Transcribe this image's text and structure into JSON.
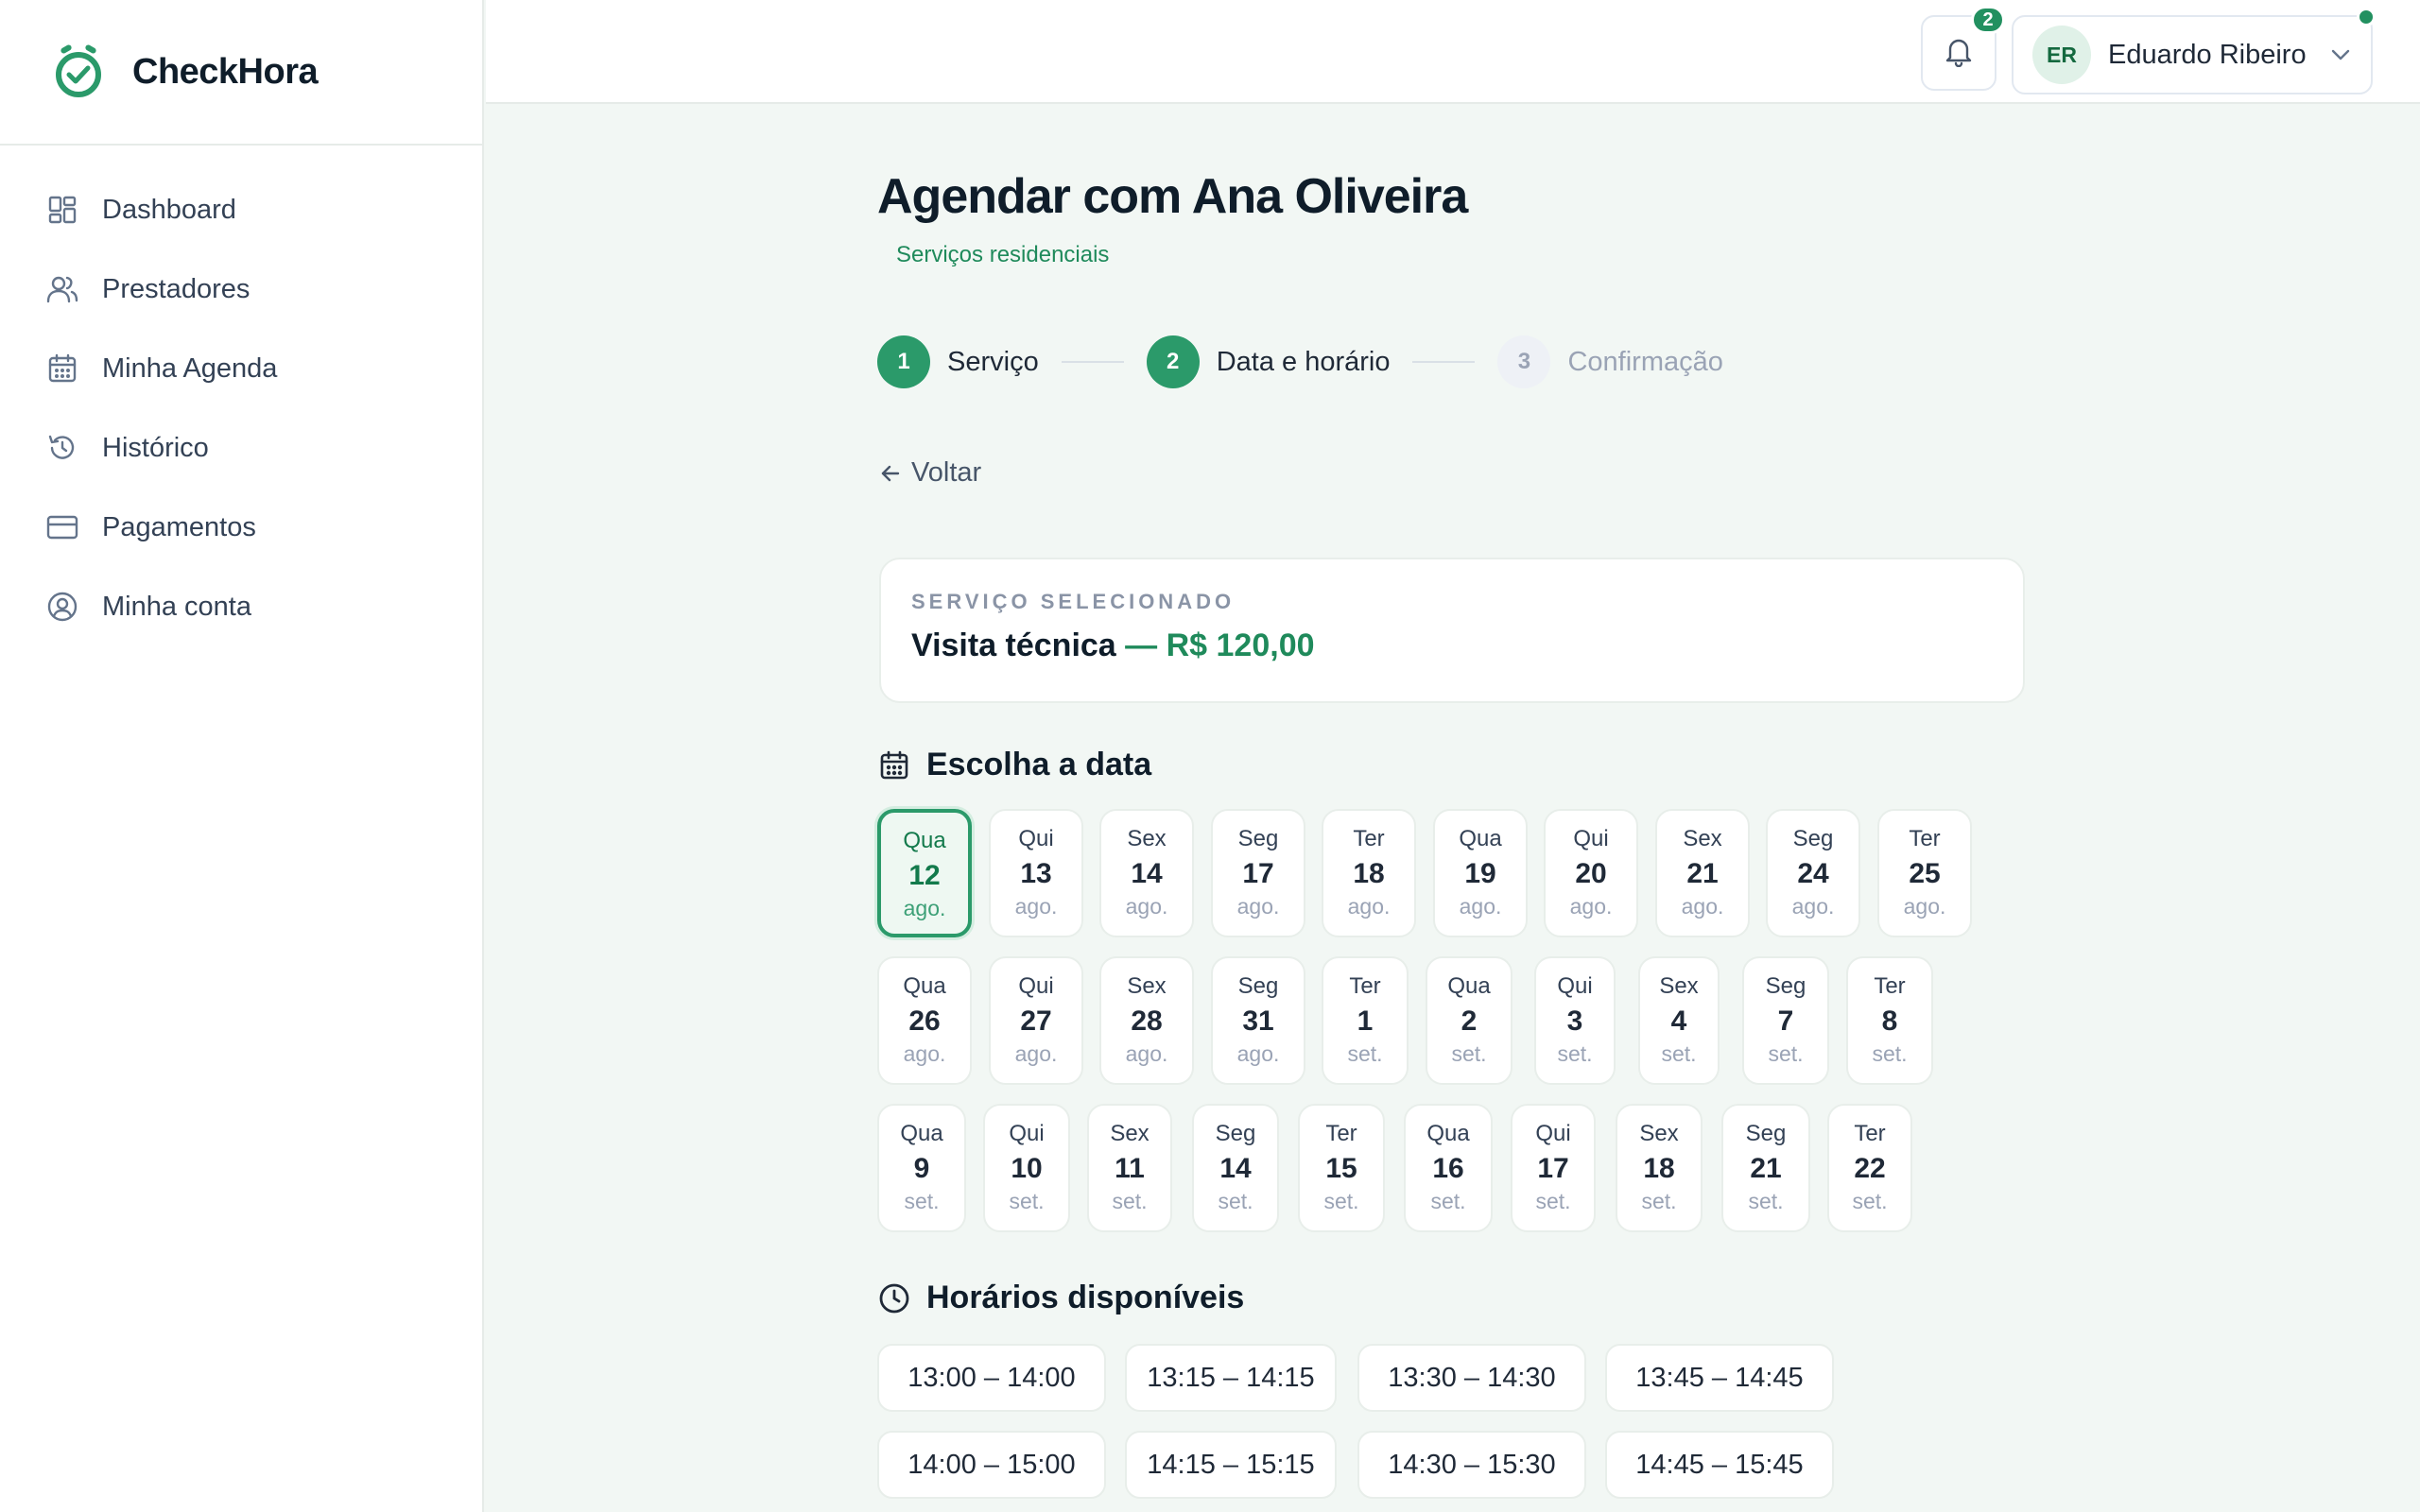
{
  "brand": {
    "name": "CheckHora"
  },
  "sidebar": {
    "items": [
      {
        "label": "Dashboard",
        "icon": "dashboard-icon"
      },
      {
        "label": "Prestadores",
        "icon": "users-icon"
      },
      {
        "label": "Minha Agenda",
        "icon": "calendar-icon"
      },
      {
        "label": "Histórico",
        "icon": "history-icon"
      },
      {
        "label": "Pagamentos",
        "icon": "credit-card-icon"
      },
      {
        "label": "Minha conta",
        "icon": "user-circle-icon"
      }
    ]
  },
  "header": {
    "notifications_count": "2",
    "user": {
      "initials": "ER",
      "name": "Eduardo Ribeiro",
      "status_color": "#229060"
    }
  },
  "page": {
    "title": "Agendar com Ana Oliveira",
    "subtitle": "Serviços residenciais",
    "back_label": "Voltar"
  },
  "stepper": {
    "steps": [
      {
        "number": "1",
        "label": "Serviço",
        "state": "done"
      },
      {
        "number": "2",
        "label": "Data e horário",
        "state": "current"
      },
      {
        "number": "3",
        "label": "Confirmação",
        "state": "pending"
      }
    ]
  },
  "service": {
    "caption": "SERVIÇO SELECIONADO",
    "name": "Visita técnica",
    "price": " — R$ 120,00"
  },
  "dates": {
    "title": "Escolha a data",
    "selected_index": 0,
    "rows": [
      [
        {
          "dow": "Qua",
          "day": "12",
          "month": "ago."
        },
        {
          "dow": "Qui",
          "day": "13",
          "month": "ago."
        },
        {
          "dow": "Sex",
          "day": "14",
          "month": "ago."
        },
        {
          "dow": "Seg",
          "day": "17",
          "month": "ago."
        },
        {
          "dow": "Ter",
          "day": "18",
          "month": "ago."
        },
        {
          "dow": "Qua",
          "day": "19",
          "month": "ago."
        },
        {
          "dow": "Qui",
          "day": "20",
          "month": "ago."
        },
        {
          "dow": "Sex",
          "day": "21",
          "month": "ago."
        },
        {
          "dow": "Seg",
          "day": "24",
          "month": "ago."
        },
        {
          "dow": "Ter",
          "day": "25",
          "month": "ago."
        }
      ],
      [
        {
          "dow": "Qua",
          "day": "26",
          "month": "ago."
        },
        {
          "dow": "Qui",
          "day": "27",
          "month": "ago."
        },
        {
          "dow": "Sex",
          "day": "28",
          "month": "ago."
        },
        {
          "dow": "Seg",
          "day": "31",
          "month": "ago."
        },
        {
          "dow": "Ter",
          "day": "1",
          "month": "set."
        },
        {
          "dow": "Qua",
          "day": "2",
          "month": "set."
        },
        {
          "dow": "Qui",
          "day": "3",
          "month": "set."
        },
        {
          "dow": "Sex",
          "day": "4",
          "month": "set."
        },
        {
          "dow": "Seg",
          "day": "7",
          "month": "set."
        },
        {
          "dow": "Ter",
          "day": "8",
          "month": "set."
        }
      ],
      [
        {
          "dow": "Qua",
          "day": "9",
          "month": "set."
        },
        {
          "dow": "Qui",
          "day": "10",
          "month": "set."
        },
        {
          "dow": "Sex",
          "day": "11",
          "month": "set."
        },
        {
          "dow": "Seg",
          "day": "14",
          "month": "set."
        },
        {
          "dow": "Ter",
          "day": "15",
          "month": "set."
        },
        {
          "dow": "Qua",
          "day": "16",
          "month": "set."
        },
        {
          "dow": "Qui",
          "day": "17",
          "month": "set."
        },
        {
          "dow": "Sex",
          "day": "18",
          "month": "set."
        },
        {
          "dow": "Seg",
          "day": "21",
          "month": "set."
        },
        {
          "dow": "Ter",
          "day": "22",
          "month": "set."
        }
      ]
    ]
  },
  "slots": {
    "title": "Horários disponíveis",
    "rows": [
      [
        "13:00 – 14:00",
        "13:15 – 14:15",
        "13:30 – 14:30",
        "13:45 – 14:45"
      ],
      [
        "14:00 – 15:00",
        "14:15 – 15:15",
        "14:30 – 15:30",
        "14:45 – 15:45"
      ]
    ]
  },
  "colors": {
    "accent": "#2b9a6a",
    "accent_text": "#1f8a5b",
    "background": "#f2f7f4"
  }
}
